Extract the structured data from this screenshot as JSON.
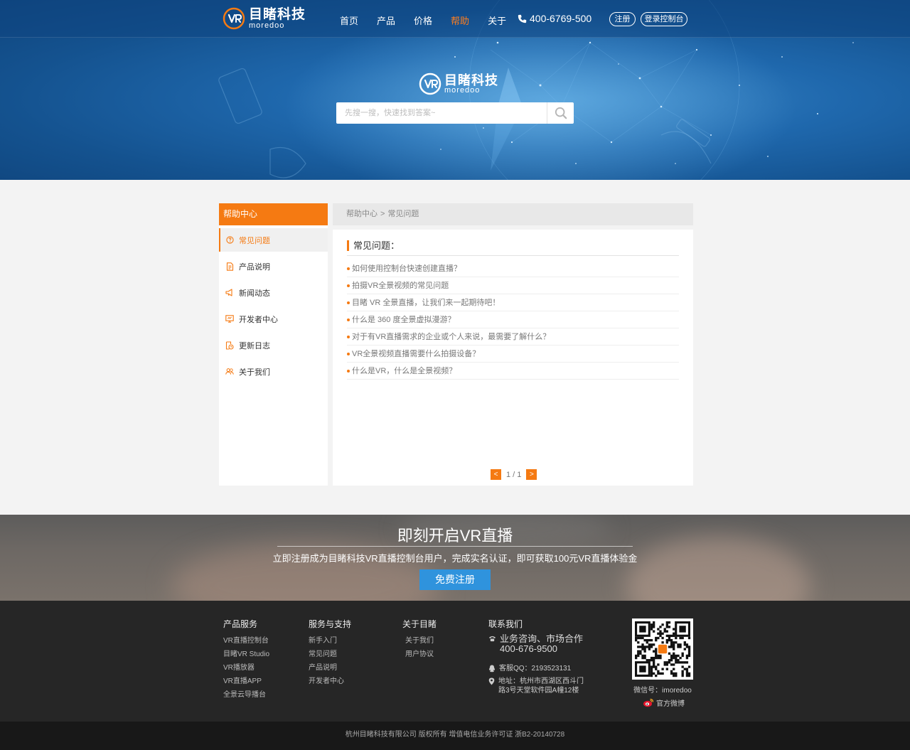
{
  "brand": {
    "name_cn": "目睹科技",
    "name_en": "moredoo",
    "mark": "VR"
  },
  "nav": {
    "items": [
      {
        "label": "首页"
      },
      {
        "label": "产品"
      },
      {
        "label": "价格"
      },
      {
        "label": "帮助",
        "active": true
      },
      {
        "label": "关于"
      }
    ],
    "phone": "400-6769-500",
    "register": "注册",
    "login": "登录控制台"
  },
  "search": {
    "placeholder": "先搜一搜，快速找到答案~"
  },
  "sidebar": {
    "title": "帮助中心",
    "items": [
      {
        "label": "常见问题",
        "icon": "faq-icon",
        "active": true
      },
      {
        "label": "产品说明",
        "icon": "document-icon"
      },
      {
        "label": "新闻动态",
        "icon": "megaphone-icon"
      },
      {
        "label": "开发者中心",
        "icon": "developer-icon"
      },
      {
        "label": "更新日志",
        "icon": "update-log-icon"
      },
      {
        "label": "关于我们",
        "icon": "people-icon"
      }
    ]
  },
  "breadcrumb": {
    "root": "帮助中心",
    "separator": ">",
    "current": "常见问题"
  },
  "content": {
    "title": "常见问题：",
    "questions": [
      "如何使用控制台快速创建直播？",
      "拍摄VR全景视频的常见问题",
      "目睹 VR 全景直播，让我们来一起期待吧！",
      "什么是 360 度全景虚拟漫游？",
      "对于有VR直播需求的企业或个人来说，最需要了解什么？",
      "VR全景视频直播需要什么拍摄设备？",
      "什么是VR，什么是全景视频？"
    ],
    "pagination": {
      "prev": "<",
      "text": "1 / 1",
      "next": ">"
    }
  },
  "cta": {
    "title": "即刻开启VR直播",
    "subtitle": "立即注册成为目睹科技VR直播控制台用户，完成实名认证，即可获取100元VR直播体验金",
    "button": "免费注册"
  },
  "footer": {
    "columns": [
      {
        "title": "产品服务",
        "links": [
          "VR直播控制台",
          "目睹VR Studio",
          "VR播放器",
          "VR直播APP",
          "全景云导播台"
        ]
      },
      {
        "title": "服务与支持",
        "links": [
          "新手入门",
          "常见问题",
          "产品说明",
          "开发者中心"
        ]
      },
      {
        "title": "关于目睹",
        "links": [
          "关于我们",
          "用户协议"
        ]
      }
    ],
    "contact": {
      "title": "联系我们",
      "business": "业务咨询、市场合作",
      "business_phone": "400-676-9500",
      "qq": "客服QQ：2193523131",
      "address_line1": "地址：杭州市西湖区西斗门",
      "address_line2": "路3号天堂软件园A幢12楼"
    },
    "wechat": "微信号：imoredoo",
    "weibo": "官方微博",
    "copyright": "杭州目睹科技有限公司 版权所有 增值电信业务许可证 浙B2-20140728"
  },
  "colors": {
    "accent": "#f57a12",
    "hero_blue": "#1f68ad",
    "cta_button": "#2f93dd",
    "footer_bg": "#262626"
  }
}
